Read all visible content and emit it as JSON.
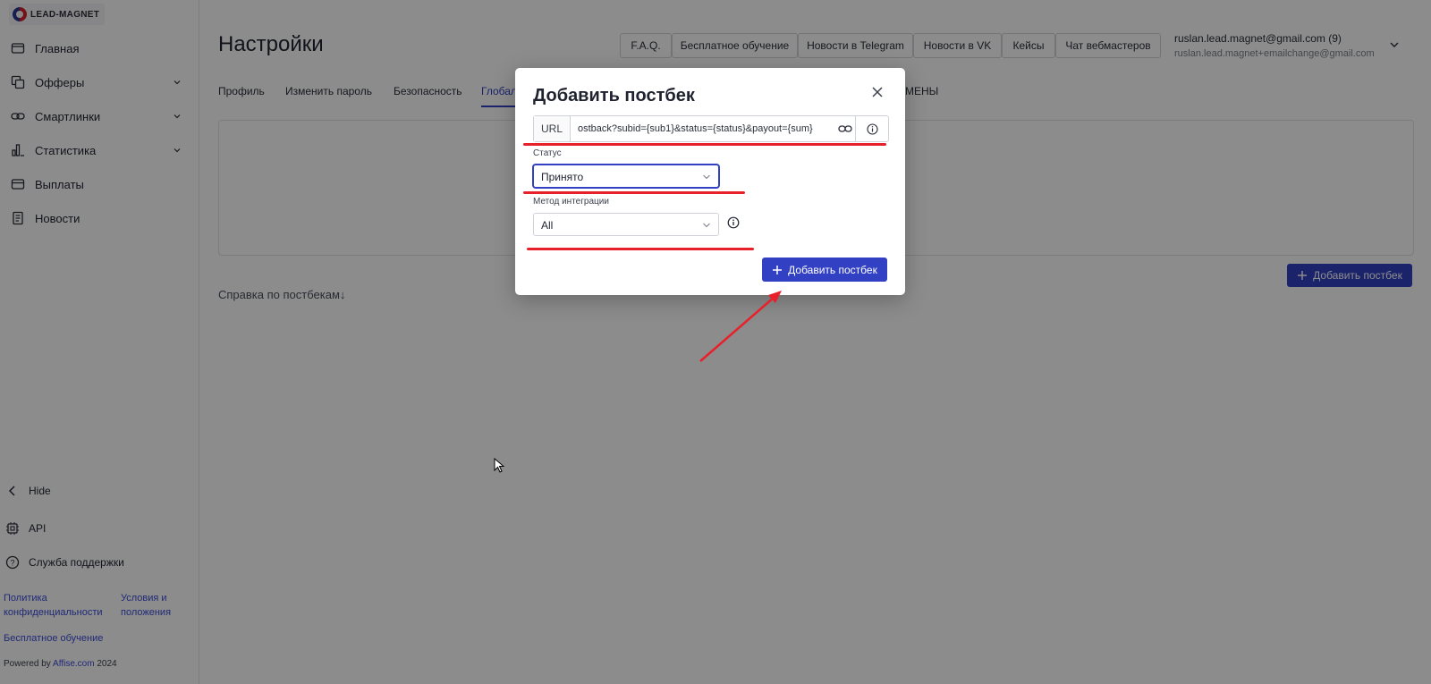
{
  "brand": {
    "name": "LEAD-MAGNET"
  },
  "sidebar": {
    "items": [
      {
        "label": "Главная",
        "icon": "home-icon"
      },
      {
        "label": "Офферы",
        "icon": "offers-icon",
        "has_submenu": true
      },
      {
        "label": "Смартлинки",
        "icon": "link-icon",
        "has_submenu": true
      },
      {
        "label": "Статистика",
        "icon": "chart-icon",
        "has_submenu": true
      },
      {
        "label": "Выплаты",
        "icon": "wallet-icon"
      },
      {
        "label": "Новости",
        "icon": "news-icon"
      }
    ],
    "hide_label": "Hide",
    "api_label": "API",
    "support_label": "Служба поддержки",
    "privacy_label": "Политика конфиденциальности",
    "terms_label": "Условия и положения",
    "training_label": "Бесплатное обучение",
    "powered_prefix": "Powered by",
    "powered_link": "Affise.com",
    "powered_year": "2024"
  },
  "header": {
    "title": "Настройки",
    "top_links": [
      "F.A.Q.",
      "Бесплатное обучение",
      "Новости в Telegram",
      "Новости в VK",
      "Кейсы",
      "Чат вебмастеров"
    ],
    "user_email": "ruslan.lead.magnet@gmail.com (9)",
    "user_email_secondary": "ruslan.lead.magnet+emailchange@gmail.com"
  },
  "tabs": [
    {
      "label": "Профиль"
    },
    {
      "label": "Изменить пароль"
    },
    {
      "label": "Безопасность"
    },
    {
      "label": "Глобал",
      "active": true
    },
    {
      "label": "МЕНЫ"
    }
  ],
  "main": {
    "add_postback_label": "Добавить постбек",
    "help_link": "Справка по постбекам"
  },
  "modal": {
    "title": "Добавить постбек",
    "url_prefix": "URL",
    "url_value": "ostback?subid={sub1}&status={status}&payout={sum}",
    "status_label": "Статус",
    "status_value": "Принято",
    "method_label": "Метод интеграции",
    "method_value": "All",
    "submit_label": "Добавить постбек"
  },
  "colors": {
    "accent": "#3241c4",
    "annotation": "#e8202a",
    "link": "#3b4bd8"
  }
}
